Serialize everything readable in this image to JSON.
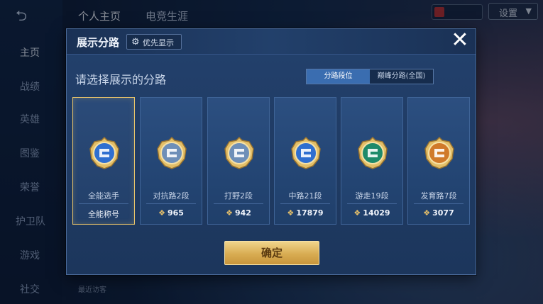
{
  "background": {
    "back_glyph": "⮌",
    "top_tabs": [
      "个人主页",
      "电竞生涯"
    ],
    "sidebar": [
      "主页",
      "战绩",
      "英雄",
      "图鉴",
      "荣誉",
      "护卫队",
      "游戏",
      "社交"
    ],
    "badge_text": "",
    "settings_label": "设置",
    "recent_visitor": "最近访客",
    "right_controls": [
      "",
      ""
    ]
  },
  "modal": {
    "title": "展示分路",
    "priority_label": "优先显示",
    "close_glyph": "✕",
    "subtitle": "请选择展示的分路",
    "segments": [
      {
        "label": "分路段位",
        "active": true
      },
      {
        "label": "巅峰分路(全国)",
        "active": false
      }
    ],
    "cards": [
      {
        "name": "全能选手",
        "foot": "全能称号",
        "score": null,
        "selected": true,
        "emblem": "all-rounder-emblem",
        "accent": "#2f6fd0"
      },
      {
        "name": "对抗路2段",
        "foot": "",
        "score": "965",
        "selected": false,
        "emblem": "clash-lane-emblem",
        "accent": "#6e8fb8"
      },
      {
        "name": "打野2段",
        "foot": "",
        "score": "942",
        "selected": false,
        "emblem": "jungle-emblem",
        "accent": "#6e8fb8"
      },
      {
        "name": "中路21段",
        "foot": "",
        "score": "17879",
        "selected": false,
        "emblem": "mid-lane-emblem",
        "accent": "#2f6fd0"
      },
      {
        "name": "游走19段",
        "foot": "",
        "score": "14029",
        "selected": false,
        "emblem": "roam-emblem",
        "accent": "#1f8a6a"
      },
      {
        "name": "发育路7段",
        "foot": "",
        "score": "3077",
        "selected": false,
        "emblem": "farm-lane-emblem",
        "accent": "#d07a2a"
      }
    ],
    "confirm_label": "确定"
  },
  "colors": {
    "gold": "#e9c46a",
    "active_segment": "#3a6db0"
  }
}
